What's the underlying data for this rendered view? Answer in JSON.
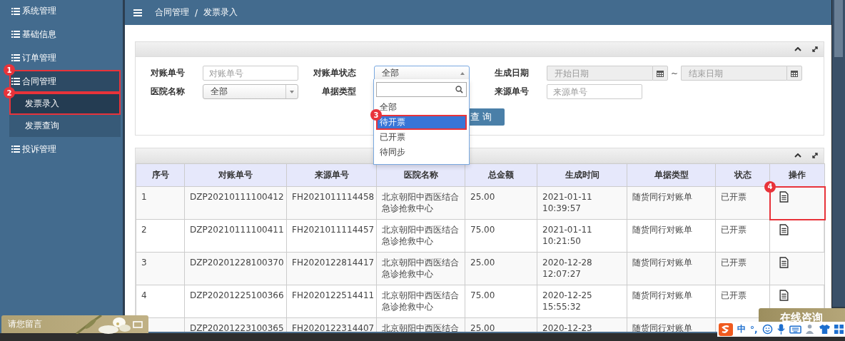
{
  "sidebar": {
    "items": [
      {
        "label": "系统管理",
        "selected": false
      },
      {
        "label": "基础信息",
        "selected": false
      },
      {
        "label": "订单管理",
        "selected": false
      },
      {
        "label": "合同管理",
        "selected": true,
        "expanded": true,
        "marker": "1",
        "children": [
          {
            "label": "发票录入",
            "selected": true,
            "marker": "2"
          },
          {
            "label": "发票查询",
            "selected": false
          }
        ]
      },
      {
        "label": "投诉管理",
        "selected": false
      }
    ]
  },
  "breadcrumb": {
    "items": [
      "合同管理",
      "发票录入"
    ],
    "separator": "/"
  },
  "filters": {
    "fields": [
      {
        "kind": "text",
        "label": "对账单号",
        "placeholder": "对账单号"
      },
      {
        "kind": "select",
        "label": "对账单状态",
        "value": "全部",
        "open": true
      },
      {
        "kind": "date-range",
        "label": "生成日期",
        "start_placeholder": "开始日期",
        "end_placeholder": "结束日期",
        "separator": "~"
      },
      {
        "kind": "select",
        "label": "医院名称",
        "value": "全部",
        "open": false
      },
      {
        "kind": "hidden",
        "label": "单据类型"
      },
      {
        "kind": "text",
        "label": "来源单号",
        "placeholder": "来源单号"
      }
    ],
    "search_button": "查 询",
    "dropdown": {
      "options": [
        {
          "label": "全部",
          "selected": false
        },
        {
          "label": "待开票",
          "selected": true,
          "marker": "3"
        },
        {
          "label": "已开票",
          "selected": false
        },
        {
          "label": "待同步",
          "selected": false
        }
      ]
    }
  },
  "table": {
    "columns": [
      "序号",
      "对账单号",
      "来源单号",
      "医院名称",
      "总金额",
      "生成时间",
      "单据类型",
      "状态",
      "操作"
    ],
    "rows": [
      {
        "index": "1",
        "number": "DZP20210111100412",
        "source": "FH2021011114458",
        "hospital": "北京朝阳中西医结合急诊抢救中心",
        "amount": "25.00",
        "time": "2021-01-11 10:39:57",
        "type": "随货同行对账单",
        "status": "已开票",
        "actions": [
          {
            "kind": "document"
          }
        ],
        "marker": "4"
      },
      {
        "index": "2",
        "number": "DZP20210111100411",
        "source": "FH2021011114457",
        "hospital": "北京朝阳中西医结合急诊抢救中心",
        "amount": "75.00",
        "time": "2021-01-11 10:21:50",
        "type": "随货同行对账单",
        "status": "已开票",
        "actions": [
          {
            "kind": "document"
          }
        ]
      },
      {
        "index": "3",
        "number": "DZP20201228100370",
        "source": "FH2020122814417",
        "hospital": "北京朝阳中西医结合急诊抢救中心",
        "amount": "25.00",
        "time": "2020-12-28 12:07:27",
        "type": "随货同行对账单",
        "status": "已开票",
        "actions": [
          {
            "kind": "document"
          }
        ]
      },
      {
        "index": "4",
        "number": "DZP20201225100366",
        "source": "FH2020122514411",
        "hospital": "北京朝阳中西医结合急诊抢救中心",
        "amount": "75.00",
        "time": "2020-12-25 15:55:32",
        "type": "随货同行对账单",
        "status": "已开票",
        "actions": [
          {
            "kind": "document"
          }
        ]
      },
      {
        "number": "DZP20201223100365",
        "source": "FH2020122314407",
        "hospital": "北京朝阳中西医结合",
        "amount": "25.00",
        "time": "2020-12-23",
        "type": "随货同行对账单"
      }
    ]
  },
  "chat_left": {
    "label": "请您留言"
  },
  "chat_right": {
    "label": "在线咨询"
  },
  "ime_bar": {
    "items": [
      {
        "kind": "logo"
      },
      {
        "kind": "text",
        "label": "中"
      },
      {
        "kind": "text",
        "label": "°,"
      },
      {
        "kind": "smiley"
      },
      {
        "kind": "mic"
      },
      {
        "kind": "keyboard"
      },
      {
        "kind": "person"
      },
      {
        "kind": "shirt"
      },
      {
        "kind": "grid"
      }
    ]
  }
}
